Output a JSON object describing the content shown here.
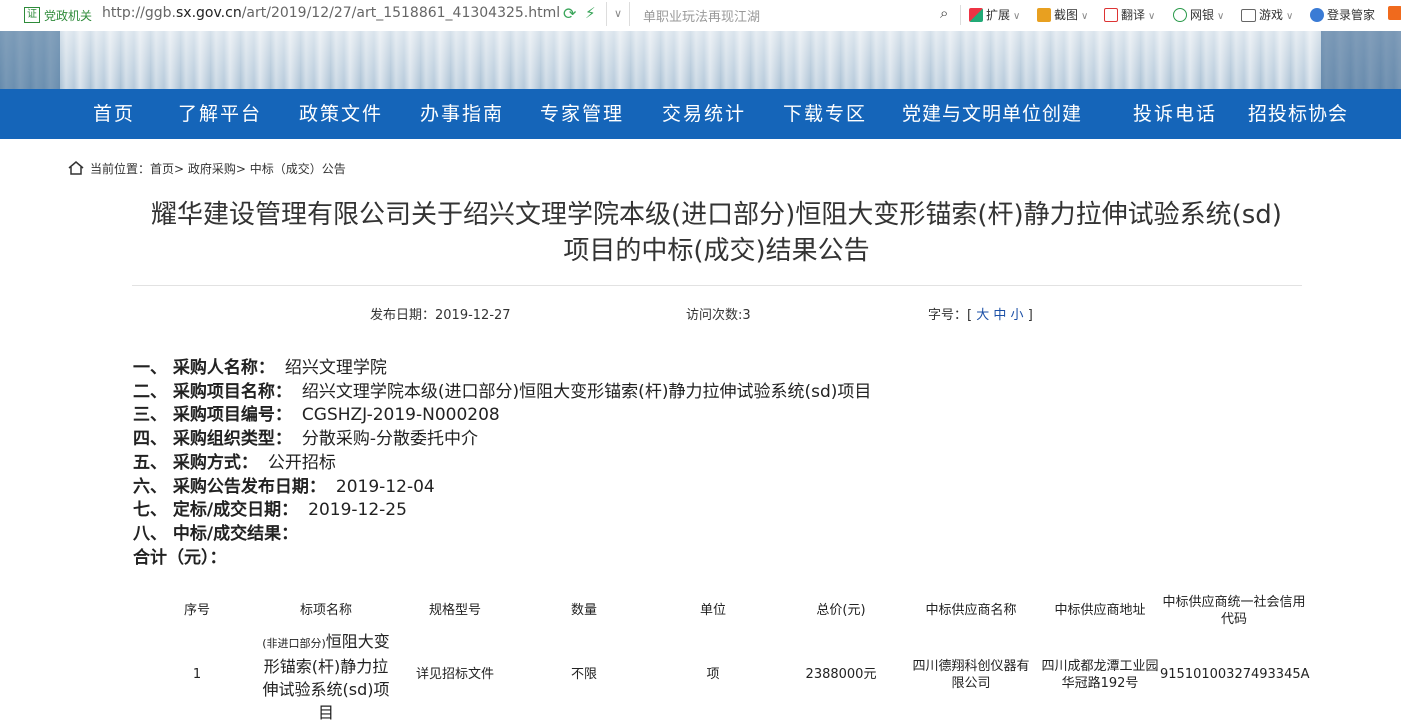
{
  "browser": {
    "gov_badge": "证",
    "gov_label": "党政机关",
    "url_prefix": "http://ggb.",
    "url_domain": "sx.gov.cn",
    "url_path": "/art/2019/12/27/art_1518861_41304325.html",
    "search_hint": "单职业玩法再现江湖",
    "toolbar": [
      "扩展",
      "截图",
      "翻译",
      "网银",
      "游戏",
      "登录管家"
    ]
  },
  "nav": [
    "首页",
    "了解平台",
    "政策文件",
    "办事指南",
    "专家管理",
    "交易统计",
    "下载专区",
    "党建与文明单位创建",
    "投诉电话",
    "招投标协会"
  ],
  "breadcrumb": "当前位置：首页> 政府采购> 中标（成交）公告",
  "title_line1": "耀华建设管理有限公司关于绍兴文理学院本级(进口部分)恒阻大变形锚索(杆)静力拉伸试验系统(sd)",
  "title_line2": "项目的中标(成交)结果公告",
  "meta": {
    "publish": "发布日期：2019-12-27",
    "visits": "访问次数:3",
    "font_label": "字号：[",
    "font_large": "大",
    "font_medium": "中",
    "font_small": "小",
    "font_close": "]"
  },
  "info": [
    {
      "k": "一、 采购人名称：",
      "v": "绍兴文理学院"
    },
    {
      "k": "二、 采购项目名称：",
      "v": "绍兴文理学院本级(进口部分)恒阻大变形锚索(杆)静力拉伸试验系统(sd)项目"
    },
    {
      "k": "三、 采购项目编号：",
      "v": "CGSHZJ-2019-N000208"
    },
    {
      "k": "四、 采购组织类型：",
      "v": "分散采购-分散委托中介"
    },
    {
      "k": "五、 采购方式：",
      "v": "公开招标"
    },
    {
      "k": "六、 采购公告发布日期：",
      "v": "2019-12-04"
    },
    {
      "k": "七、 定标/成交日期：",
      "v": "2019-12-25"
    },
    {
      "k": "八、 中标/成交结果：",
      "v": ""
    },
    {
      "k": "合计（元）：",
      "v": ""
    }
  ],
  "table": {
    "headers": [
      "序号",
      "标项名称",
      "规格型号",
      "数量",
      "单位",
      "总价(元)",
      "中标供应商名称",
      "中标供应商地址",
      "中标供应商统一社会信用代码"
    ],
    "row": {
      "no": "1",
      "name_small": "(非进口部分)",
      "name_main": "恒阻大变形锚索(杆)静力拉伸试验系统(sd)项目",
      "spec": "详见招标文件",
      "qty": "不限",
      "unit": "项",
      "total": "2388000元",
      "supplier": "四川德翔科创仪器有限公司",
      "address": "四川成都龙潭工业园华冠路192号",
      "code": "91510100327493345A"
    }
  }
}
